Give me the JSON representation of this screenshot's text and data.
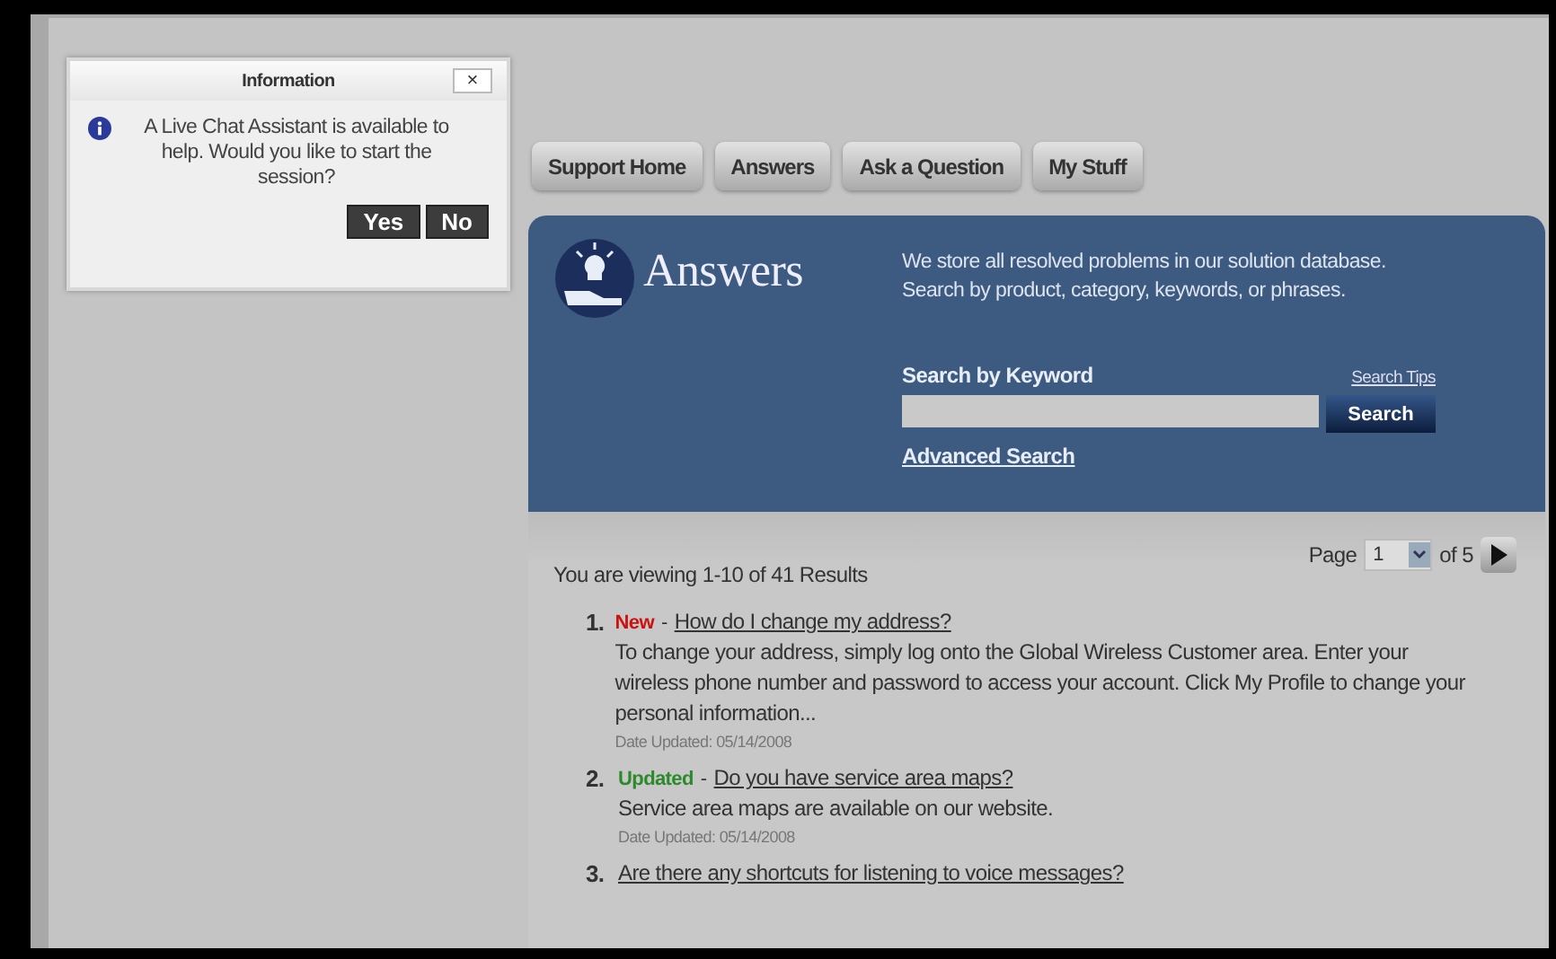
{
  "dialog": {
    "title": "Information",
    "close": "×",
    "message": "A Live Chat Assistant is available to help. Would you like to start the session?",
    "buttons": [
      "Yes",
      "No"
    ]
  },
  "nav_tabs": [
    "Support Home",
    "Answers",
    "Ask a Question",
    "My Stuff"
  ],
  "banner": {
    "title": "Answers",
    "description": "We store all resolved problems in our solution database. Search by product, category, keywords, or phrases.",
    "search_label": "Search by Keyword",
    "search_tips": "Search Tips",
    "search_button": "Search",
    "advanced_search": "Advanced Search"
  },
  "results": {
    "summary": "You are viewing 1-10 of 41 Results",
    "page_label": "Page",
    "page_value": "1",
    "page_total": "of 5",
    "items": [
      {
        "number": "1.",
        "tag": {
          "kind": "new",
          "label": "New"
        },
        "separator": "-",
        "title": "How do I change my address?",
        "summary": "To change your address, simply log onto the Global Wireless Customer area. Enter your wireless phone number and password to access your account. Click My Profile to change your personal information...",
        "date": "Date Updated: 05/14/2008"
      },
      {
        "number": "2.",
        "tag": {
          "kind": "updated",
          "label": "Updated"
        },
        "separator": "-",
        "title": "Do you have service area maps?",
        "summary": "Service area maps are available on our website.",
        "date": "Date Updated: 05/14/2008"
      },
      {
        "number": "3.",
        "title": "Are there any shortcuts for listening to voice messages?"
      }
    ]
  }
}
